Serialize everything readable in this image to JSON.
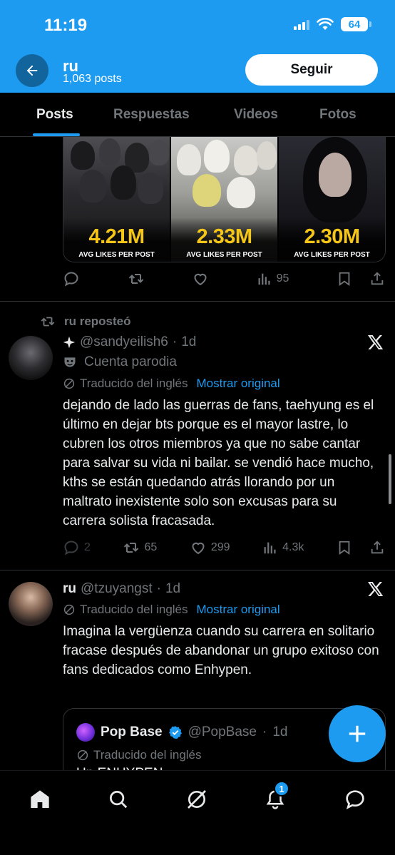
{
  "status_bar": {
    "time": "11:19",
    "battery": "64"
  },
  "profile": {
    "name": "ru",
    "posts": "1,063 posts",
    "follow_label": "Seguir"
  },
  "tabs": [
    {
      "label": "Posts",
      "active": true
    },
    {
      "label": "Respuestas"
    },
    {
      "label": "Videos"
    },
    {
      "label": "Fotos"
    }
  ],
  "media_post": {
    "stats": [
      {
        "value": "4.21M",
        "label": "AVG LIKES PER POST"
      },
      {
        "value": "2.33M",
        "label": "AVG LIKES PER POST"
      },
      {
        "value": "2.30M",
        "label": "AVG LIKES PER POST"
      }
    ],
    "actions": {
      "views": "95"
    }
  },
  "repost_label": "ru reposteó",
  "tweet1": {
    "handle": "@sandyeilish6",
    "time": "1d",
    "parody_label": "Cuenta parodia",
    "translated_label": "Traducido del inglés",
    "show_original": "Mostrar original",
    "text": "dejando de lado las guerras de fans, taehyung es el último en dejar bts porque es el mayor lastre, lo cubren los otros miembros ya que no sabe cantar para salvar su vida ni bailar. se vendió hace mucho, kths se están quedando atrás llorando por un maltrato inexistente solo son excusas para su carrera solista fracasada.",
    "actions": {
      "replies": "2",
      "reposts": "65",
      "likes": "299",
      "views": "4.3k"
    }
  },
  "tweet2": {
    "name": "ru",
    "handle": "@tzuyangst",
    "time": "1d",
    "translated_label": "Traducido del inglés",
    "show_original": "Mostrar original",
    "text": "Imagina la vergüenza cuando su carrera en solitario fracase después de abandonar un grupo exitoso con fans dedicados como Enhypen.",
    "quote": {
      "name": "Pop Base",
      "handle": "@PopBase",
      "time": "1d",
      "translated_label": "Traducido del inglés",
      "cut_text": "Un                                ENHYPEN"
    }
  },
  "notifications_badge": "1",
  "colors": {
    "accent": "#1d9bf0",
    "background": "#000000",
    "muted": "#71767b",
    "stat_yellow": "#f5c518"
  }
}
